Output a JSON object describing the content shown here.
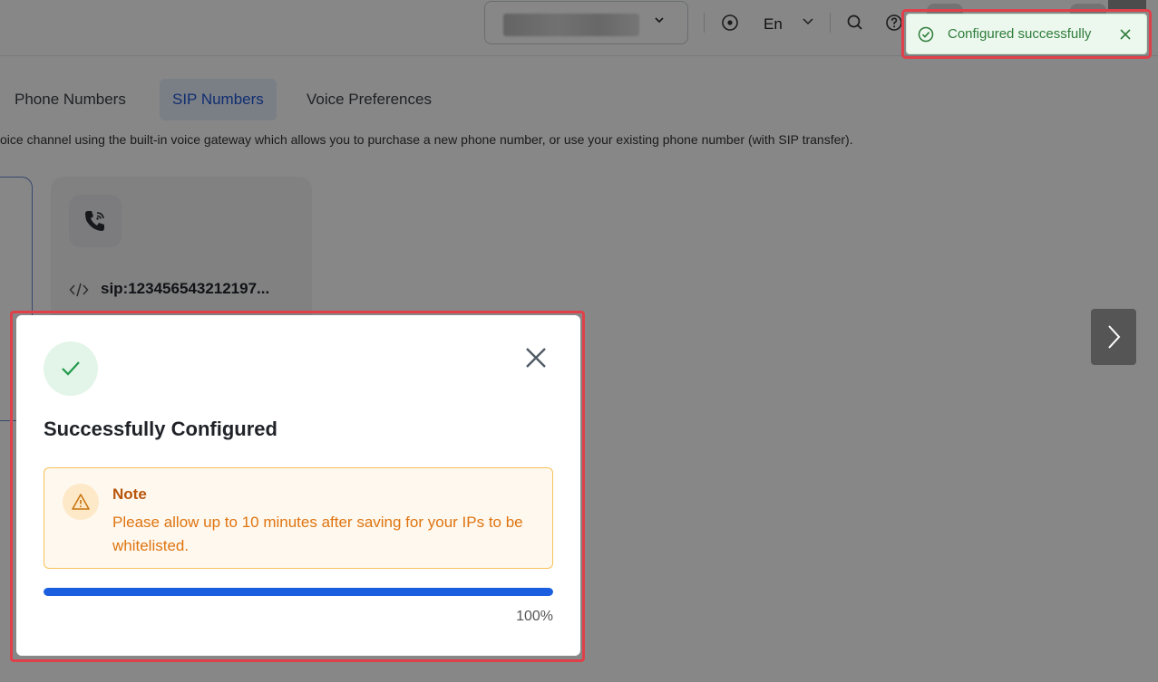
{
  "header": {
    "language": "En"
  },
  "tabs": [
    {
      "label": "Phone Numbers",
      "active": false
    },
    {
      "label": "SIP Numbers",
      "active": true
    },
    {
      "label": "Voice Preferences",
      "active": false
    }
  ],
  "description": "oice channel using the built-in voice gateway which allows you to purchase a new phone number, or use your existing phone number (with SIP transfer).",
  "sip_card": {
    "address": "sip:123456543212197..."
  },
  "toast": {
    "message": "Configured successfully",
    "color": "#2e7d3a"
  },
  "dialog": {
    "title": "Successfully Configured",
    "note_title": "Note",
    "note_body": "Please allow up to 10 minutes after saving for your IPs to be whitelisted.",
    "progress": 1.0,
    "progress_label": "100%",
    "accent": "#1b5fe0"
  },
  "icons": {
    "header": [
      "chevron-down-icon",
      "target-icon",
      "chevron-down-icon",
      "search-icon",
      "help-icon"
    ],
    "sip": [
      "phone-call-icon",
      "code-icon"
    ],
    "dialog": [
      "check-icon",
      "close-icon",
      "warning-icon"
    ],
    "toast": [
      "check-circle-icon",
      "close-icon"
    ],
    "nav": [
      "chevron-right-icon"
    ]
  }
}
